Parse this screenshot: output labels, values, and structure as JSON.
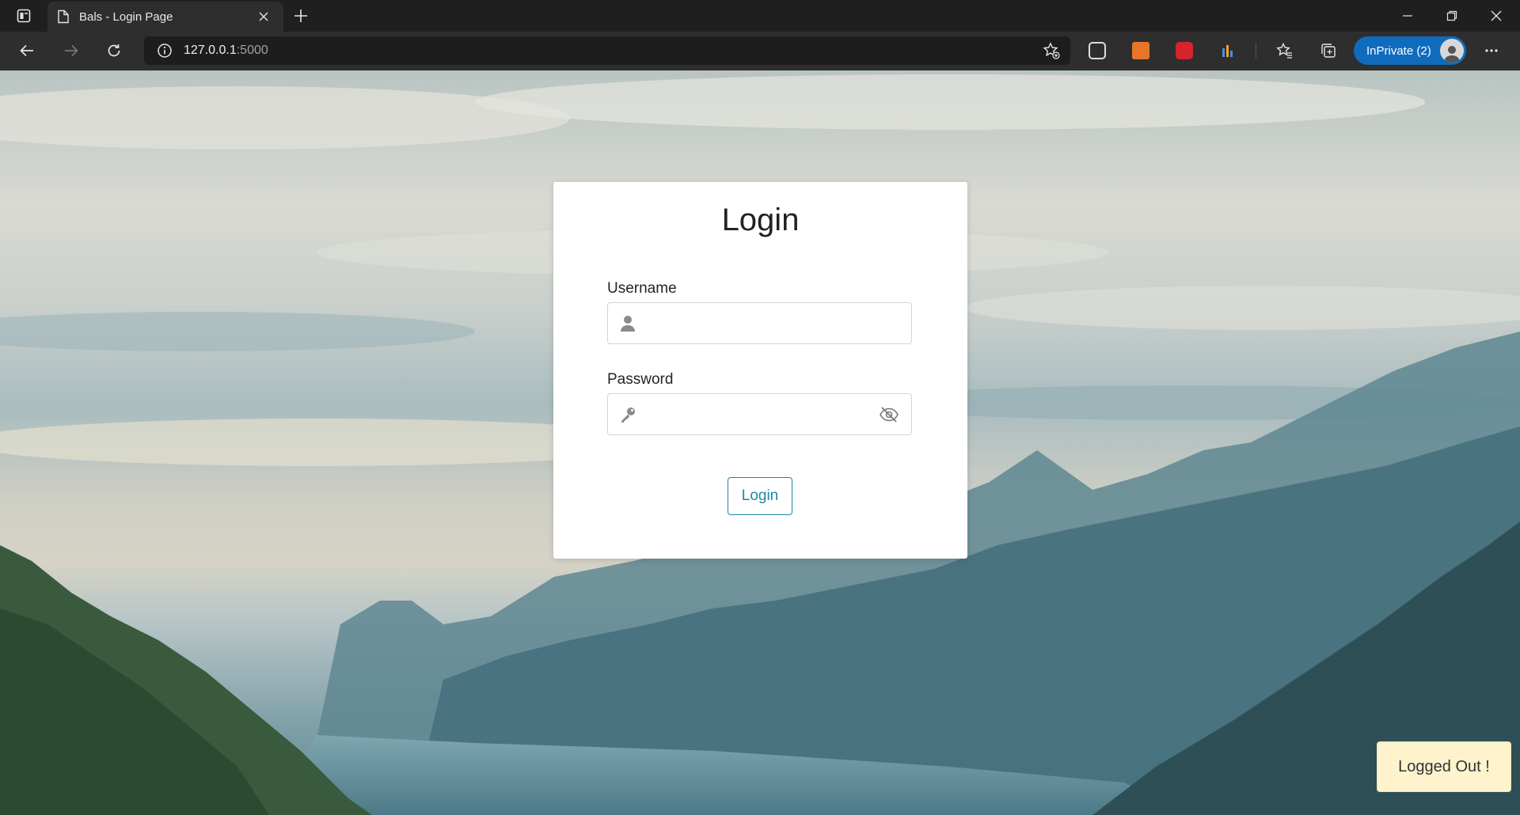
{
  "browser": {
    "tab_title": "Bals - Login Page",
    "url_host": "127.0.0.1",
    "url_port": ":5000",
    "profile_label": "InPrivate (2)",
    "accent_color": "#0f6cbd"
  },
  "icons": {
    "tab_actions": "tab-actions-icon",
    "page": "page-icon",
    "close": "close-icon",
    "new_tab": "plus-icon",
    "back": "back-arrow-icon",
    "forward": "forward-arrow-icon",
    "refresh": "refresh-icon",
    "info": "info-icon",
    "add_favorite": "star-plus-icon",
    "favorites": "favorites-icon",
    "collections": "collections-icon",
    "more": "more-icon",
    "user": "user-icon",
    "key": "key-icon",
    "eye_slash": "eye-slash-icon"
  },
  "login": {
    "title": "Login",
    "username_label": "Username",
    "username_value": "",
    "password_label": "Password",
    "password_value": "",
    "submit_label": "Login",
    "button_color": "#1a8aa6"
  },
  "toast": {
    "message": "Logged Out !",
    "background": "#fff3cd"
  }
}
